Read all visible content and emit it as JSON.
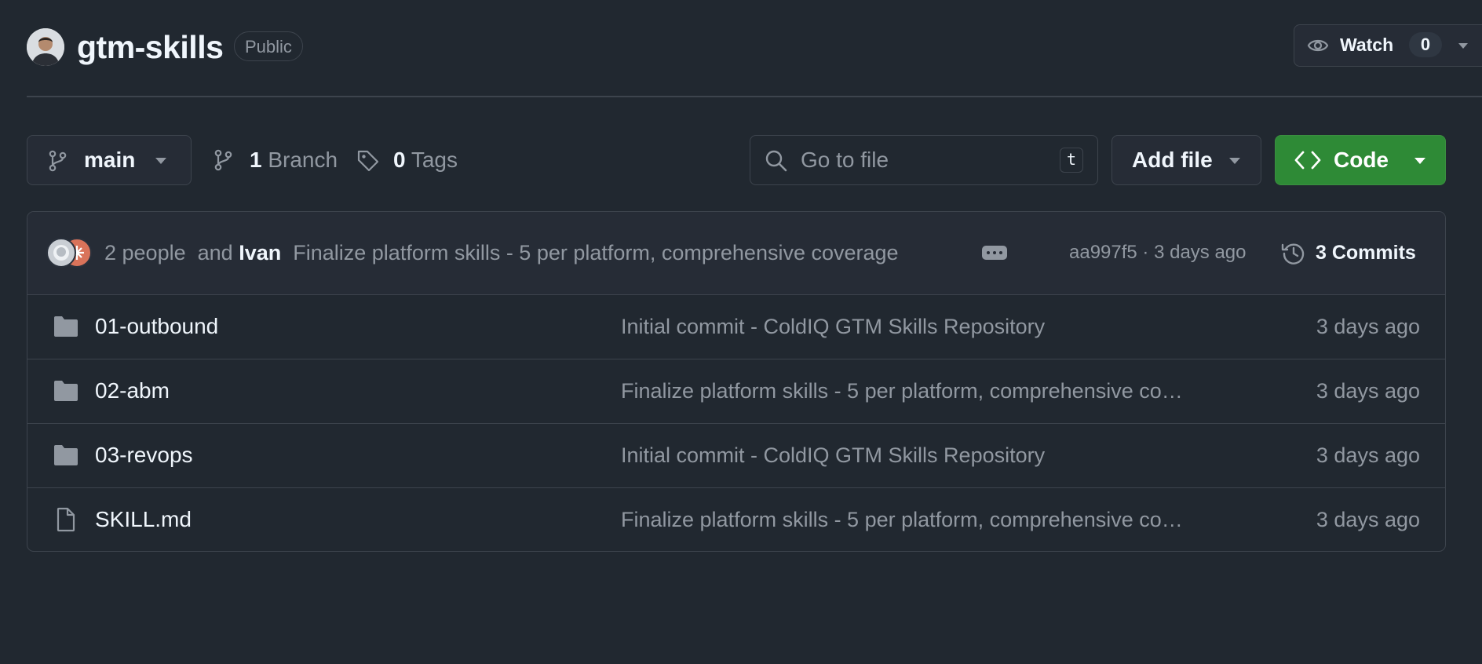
{
  "repo": {
    "owner_avatar_icon": "user-avatar",
    "name": "gtm-skills",
    "visibility": "Public"
  },
  "watch": {
    "icon": "eye-icon",
    "label": "Watch",
    "count": "0"
  },
  "toolbar": {
    "branch": "main",
    "branches_count": "1",
    "branches_label": "Branch",
    "tags_count": "0",
    "tags_label": "Tags",
    "search_placeholder": "Go to file",
    "search_shortcut": "t",
    "add_file_label": "Add file",
    "code_label": "Code"
  },
  "latest_commit": {
    "authors_text": "2 people",
    "and_text": "and",
    "author": "Ivan",
    "message": "Finalize platform skills - 5 per platform, comprehensive coverage",
    "hash_time": "aa997f5 · 3 days ago",
    "commits_label": "3 Commits"
  },
  "files": [
    {
      "type": "folder",
      "name": "01-outbound",
      "message": "Initial commit - ColdIQ GTM Skills Repository",
      "age": "3 days ago"
    },
    {
      "type": "folder",
      "name": "02-abm",
      "message": "Finalize platform skills - 5 per platform, comprehensive co…",
      "age": "3 days ago"
    },
    {
      "type": "folder",
      "name": "03-revops",
      "message": "Initial commit - ColdIQ GTM Skills Repository",
      "age": "3 days ago"
    },
    {
      "type": "file",
      "name": "SKILL.md",
      "message": "Finalize platform skills - 5 per platform, comprehensive co…",
      "age": "3 days ago"
    }
  ],
  "colors": {
    "background": "#212830",
    "border": "#3d444d",
    "muted_text": "#9198a1",
    "primary_text": "#f0f6fc",
    "code_button": "#2e8a36"
  }
}
